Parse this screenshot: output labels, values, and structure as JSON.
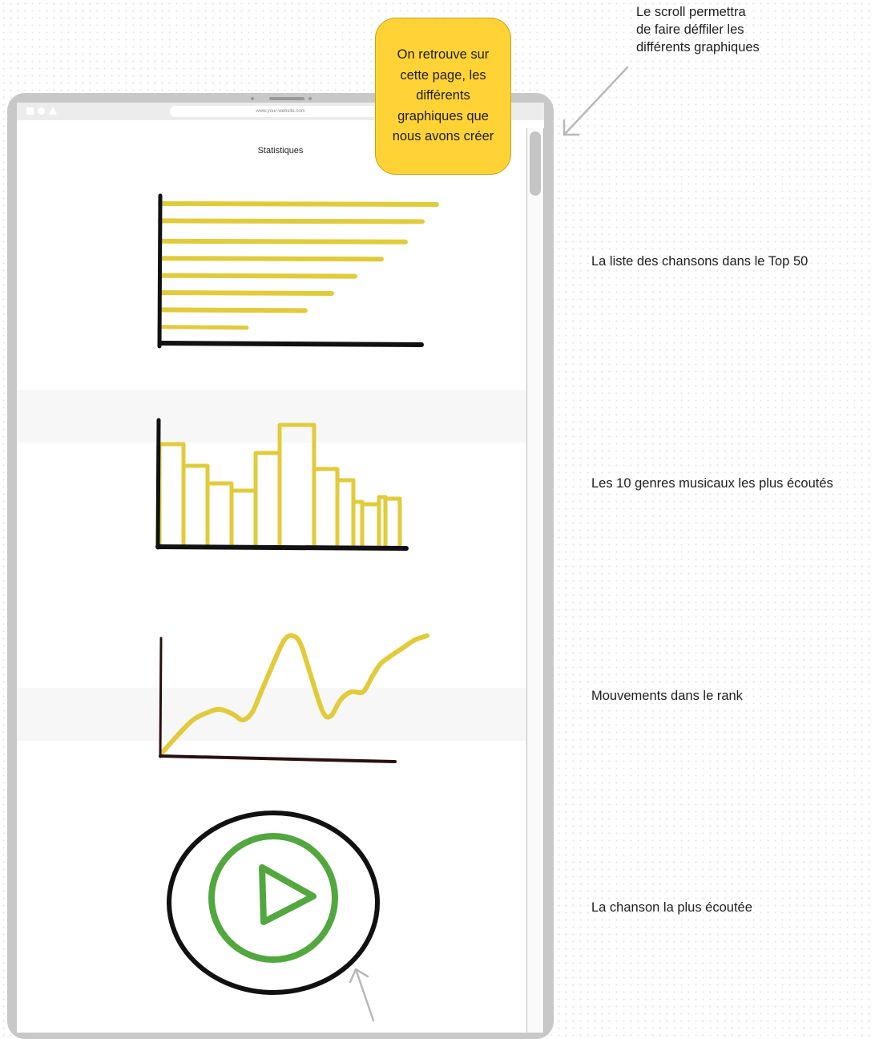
{
  "annotations": {
    "scroll_note": [
      "Le scroll permettra",
      "de faire déffiler les",
      "différents graphiques"
    ],
    "sticky_note": [
      "On retrouve sur",
      "cette page, les",
      "différents",
      "graphiques que",
      "nous avons créer"
    ],
    "chart1_label": "La liste des chansons dans le Top 50",
    "chart2_label": "Les 10 genres musicaux les plus écoutés",
    "chart3_label": "Mouvements dans le rank",
    "chart4_label": "La chanson la plus écoutée"
  },
  "browser": {
    "url": "www.your-website.com",
    "page_title": "Statistiques"
  },
  "colors": {
    "accent_yellow": "#e2cb3b",
    "sticky_yellow": "#ffd335",
    "play_green": "#52a83e",
    "axis_black": "#111111",
    "tablet_gray": "#c8c8c8"
  },
  "icons": {
    "player": "play-icon",
    "arrows": "arrow-icon"
  },
  "chart_data": [
    {
      "type": "bar",
      "orientation": "horizontal",
      "values": [
        345,
        327,
        306,
        276,
        243,
        214,
        181,
        108
      ]
    },
    {
      "type": "bar",
      "values": [
        128,
        101,
        79,
        70,
        117,
        152,
        97,
        83,
        56,
        53,
        62,
        60
      ]
    },
    {
      "type": "line",
      "x": [
        0,
        18,
        38,
        58,
        72,
        88,
        100,
        112,
        125,
        140,
        152,
        162,
        172,
        185,
        200,
        210,
        222,
        235,
        250,
        262,
        272,
        285,
        300,
        315,
        330
      ],
      "values": [
        5,
        25,
        45,
        55,
        58,
        52,
        45,
        55,
        85,
        120,
        145,
        150,
        140,
        100,
        55,
        50,
        70,
        80,
        80,
        100,
        115,
        125,
        135,
        145,
        150
      ]
    }
  ]
}
